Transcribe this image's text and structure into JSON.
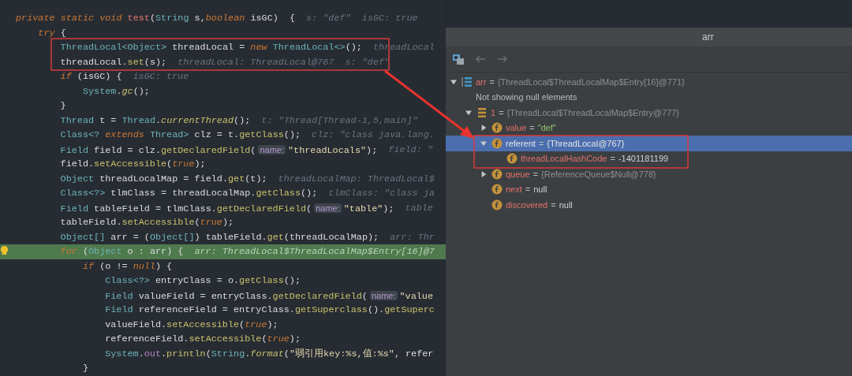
{
  "editor": {
    "lines": [
      {
        "current": false,
        "tokens": [
          {
            "kind": "kw",
            "t": "private static void "
          },
          {
            "kind": "def",
            "t": "test"
          },
          {
            "kind": "txt",
            "t": "("
          },
          {
            "kind": "type",
            "t": "String"
          },
          {
            "kind": "txt",
            "t": " s,"
          },
          {
            "kind": "kw",
            "t": "boolean"
          },
          {
            "kind": "txt",
            "t": " isGC)  {"
          }
        ],
        "hint": "s: \"def\"  isGC: true",
        "children": [
          {
            "current": false,
            "tokens": [
              {
                "kind": "kw",
                "t": "try"
              },
              {
                "kind": "txt",
                "t": " {"
              }
            ],
            "children": [
              {
                "current": false,
                "tokens": [
                  {
                    "kind": "type",
                    "t": "ThreadLocal<Object>"
                  },
                  {
                    "kind": "txt",
                    "t": " threadLocal = "
                  },
                  {
                    "kind": "kw",
                    "t": "new "
                  },
                  {
                    "kind": "type",
                    "t": "ThreadLocal<>"
                  },
                  {
                    "kind": "txt",
                    "t": "();"
                  }
                ],
                "hint": "threadLocal"
              },
              {
                "current": false,
                "tokens": [
                  {
                    "kind": "txt",
                    "t": "threadLocal."
                  },
                  {
                    "kind": "fn",
                    "t": "set"
                  },
                  {
                    "kind": "txt",
                    "t": "(s);"
                  }
                ],
                "hint": "threadLocal: ThreadLocal@767  s: \"def\""
              },
              {
                "current": false,
                "tokens": [
                  {
                    "kind": "kw",
                    "t": "if"
                  },
                  {
                    "kind": "txt",
                    "t": " (isGC) {"
                  }
                ],
                "hint": "isGC: true",
                "children": [
                  {
                    "current": false,
                    "tokens": [
                      {
                        "kind": "type",
                        "t": "System"
                      },
                      {
                        "kind": "txt",
                        "t": "."
                      },
                      {
                        "kind": "fni",
                        "t": "gc"
                      },
                      {
                        "kind": "txt",
                        "t": "();"
                      }
                    ]
                  }
                ]
              },
              {
                "current": false,
                "tokens": [
                  {
                    "kind": "txt",
                    "t": "}"
                  }
                ]
              },
              {
                "current": false,
                "tokens": [
                  {
                    "kind": "type",
                    "t": "Thread"
                  },
                  {
                    "kind": "txt",
                    "t": " t = "
                  },
                  {
                    "kind": "type",
                    "t": "Thread"
                  },
                  {
                    "kind": "txt",
                    "t": "."
                  },
                  {
                    "kind": "fni",
                    "t": "currentThread"
                  },
                  {
                    "kind": "txt",
                    "t": "();"
                  }
                ],
                "hint": "t: \"Thread[Thread-1,5,main]\""
              },
              {
                "current": false,
                "tokens": [
                  {
                    "kind": "type",
                    "t": "Class<?"
                  },
                  {
                    "kind": "kw",
                    "t": " extends "
                  },
                  {
                    "kind": "type",
                    "t": "Thread>"
                  },
                  {
                    "kind": "txt",
                    "t": " clz = t."
                  },
                  {
                    "kind": "fn",
                    "t": "getClass"
                  },
                  {
                    "kind": "txt",
                    "t": "();"
                  }
                ],
                "hint": "clz: \"class java.lang."
              },
              {
                "current": false,
                "tokens": [
                  {
                    "kind": "type",
                    "t": "Field"
                  },
                  {
                    "kind": "txt",
                    "t": " field = clz."
                  },
                  {
                    "kind": "fn",
                    "t": "getDeclaredField"
                  },
                  {
                    "kind": "txt",
                    "t": "("
                  },
                  {
                    "kind": "param",
                    "t": "name:"
                  },
                  {
                    "kind": "str",
                    "t": "\"threadLocals\""
                  },
                  {
                    "kind": "txt",
                    "t": ");"
                  }
                ],
                "hint": "field: \""
              },
              {
                "current": false,
                "tokens": [
                  {
                    "kind": "txt",
                    "t": "field."
                  },
                  {
                    "kind": "fn",
                    "t": "setAccessible"
                  },
                  {
                    "kind": "txt",
                    "t": "("
                  },
                  {
                    "kind": "kw",
                    "t": "true"
                  },
                  {
                    "kind": "txt",
                    "t": ");"
                  }
                ]
              },
              {
                "current": false,
                "tokens": [
                  {
                    "kind": "type",
                    "t": "Object"
                  },
                  {
                    "kind": "txt",
                    "t": " threadLocalMap = field."
                  },
                  {
                    "kind": "fn",
                    "t": "get"
                  },
                  {
                    "kind": "txt",
                    "t": "(t);"
                  }
                ],
                "hint": "threadLocalMap: ThreadLocal$"
              },
              {
                "current": false,
                "tokens": [
                  {
                    "kind": "type",
                    "t": "Class<?>"
                  },
                  {
                    "kind": "txt",
                    "t": " tlmClass = threadLocalMap."
                  },
                  {
                    "kind": "fn",
                    "t": "getClass"
                  },
                  {
                    "kind": "txt",
                    "t": "();"
                  }
                ],
                "hint": "tlmClass: \"class ja"
              },
              {
                "current": false,
                "tokens": [
                  {
                    "kind": "type",
                    "t": "Field"
                  },
                  {
                    "kind": "txt",
                    "t": " tableField = tlmClass."
                  },
                  {
                    "kind": "fn",
                    "t": "getDeclaredField"
                  },
                  {
                    "kind": "txt",
                    "t": "("
                  },
                  {
                    "kind": "param",
                    "t": "name:"
                  },
                  {
                    "kind": "str",
                    "t": "\"table\""
                  },
                  {
                    "kind": "txt",
                    "t": ");"
                  }
                ],
                "hint": "table"
              },
              {
                "current": false,
                "tokens": [
                  {
                    "kind": "txt",
                    "t": "tableField."
                  },
                  {
                    "kind": "fn",
                    "t": "setAccessible"
                  },
                  {
                    "kind": "txt",
                    "t": "("
                  },
                  {
                    "kind": "kw",
                    "t": "true"
                  },
                  {
                    "kind": "txt",
                    "t": ");"
                  }
                ]
              },
              {
                "current": false,
                "tokens": [
                  {
                    "kind": "type",
                    "t": "Object[]"
                  },
                  {
                    "kind": "txt",
                    "t": " arr = ("
                  },
                  {
                    "kind": "type",
                    "t": "Object[]"
                  },
                  {
                    "kind": "txt",
                    "t": ") tableField."
                  },
                  {
                    "kind": "fn",
                    "t": "get"
                  },
                  {
                    "kind": "txt",
                    "t": "(threadLocalMap);"
                  }
                ],
                "hint": "arr: Thr"
              },
              {
                "current": true,
                "tokens": [
                  {
                    "kind": "kw",
                    "t": "for"
                  },
                  {
                    "kind": "txt",
                    "t": " ("
                  },
                  {
                    "kind": "type",
                    "t": "Object"
                  },
                  {
                    "kind": "txt",
                    "t": " o : arr) {"
                  }
                ],
                "hint": "arr: ThreadLocal$ThreadLocalMap$Entry[16]@7",
                "children": [
                  {
                    "current": false,
                    "tokens": [
                      {
                        "kind": "kw",
                        "t": "if"
                      },
                      {
                        "kind": "txt",
                        "t": " (o != "
                      },
                      {
                        "kind": "kw",
                        "t": "null"
                      },
                      {
                        "kind": "txt",
                        "t": ") {"
                      }
                    ],
                    "children": [
                      {
                        "current": false,
                        "tokens": [
                          {
                            "kind": "type",
                            "t": "Class<?>"
                          },
                          {
                            "kind": "txt",
                            "t": " entryClass = o."
                          },
                          {
                            "kind": "fn",
                            "t": "getClass"
                          },
                          {
                            "kind": "txt",
                            "t": "();"
                          }
                        ]
                      },
                      {
                        "current": false,
                        "tokens": [
                          {
                            "kind": "type",
                            "t": "Field"
                          },
                          {
                            "kind": "txt",
                            "t": " valueField = entryClass."
                          },
                          {
                            "kind": "fn",
                            "t": "getDeclaredField"
                          },
                          {
                            "kind": "txt",
                            "t": "("
                          },
                          {
                            "kind": "param",
                            "t": "name:"
                          },
                          {
                            "kind": "str",
                            "t": "\"value"
                          }
                        ]
                      },
                      {
                        "current": false,
                        "tokens": [
                          {
                            "kind": "type",
                            "t": "Field"
                          },
                          {
                            "kind": "txt",
                            "t": " referenceField = entryClass."
                          },
                          {
                            "kind": "fn",
                            "t": "getSuperclass"
                          },
                          {
                            "kind": "txt",
                            "t": "()."
                          },
                          {
                            "kind": "fn",
                            "t": "getSuperc"
                          }
                        ]
                      },
                      {
                        "current": false,
                        "tokens": [
                          {
                            "kind": "txt",
                            "t": "valueField."
                          },
                          {
                            "kind": "fn",
                            "t": "setAccessible"
                          },
                          {
                            "kind": "txt",
                            "t": "("
                          },
                          {
                            "kind": "kw",
                            "t": "true"
                          },
                          {
                            "kind": "txt",
                            "t": ");"
                          }
                        ]
                      },
                      {
                        "current": false,
                        "tokens": [
                          {
                            "kind": "txt",
                            "t": "referenceField."
                          },
                          {
                            "kind": "fn",
                            "t": "setAccessible"
                          },
                          {
                            "kind": "txt",
                            "t": "("
                          },
                          {
                            "kind": "kw",
                            "t": "true"
                          },
                          {
                            "kind": "txt",
                            "t": ");"
                          }
                        ]
                      },
                      {
                        "current": false,
                        "tokens": [
                          {
                            "kind": "type",
                            "t": "System"
                          },
                          {
                            "kind": "txt",
                            "t": "."
                          },
                          {
                            "kind": "field",
                            "t": "out"
                          },
                          {
                            "kind": "txt",
                            "t": "."
                          },
                          {
                            "kind": "fn",
                            "t": "println"
                          },
                          {
                            "kind": "txt",
                            "t": "("
                          },
                          {
                            "kind": "type",
                            "t": "String"
                          },
                          {
                            "kind": "txt",
                            "t": "."
                          },
                          {
                            "kind": "fni",
                            "t": "format"
                          },
                          {
                            "kind": "txt",
                            "t": "("
                          },
                          {
                            "kind": "str",
                            "t": "\"弱引用key:%s,值:%s\""
                          },
                          {
                            "kind": "txt",
                            "t": ", refer"
                          }
                        ]
                      }
                    ]
                  },
                  {
                    "current": false,
                    "tokens": [
                      {
                        "kind": "txt",
                        "t": "}"
                      }
                    ]
                  }
                ]
              }
            ]
          }
        ]
      }
    ]
  },
  "popup": {
    "title": "arr",
    "tree": [
      {
        "kind": "array",
        "name": "arr",
        "separator": "=",
        "value": {
          "kind": "object",
          "text": "{ThreadLocal$ThreadLocalMap$Entry[16]@771}"
        },
        "expanded": true,
        "selected": false,
        "children": [
          {
            "kind": "note",
            "text": "Not showing null elements"
          },
          {
            "kind": "entry",
            "name": "1",
            "separator": "=",
            "value": {
              "kind": "object",
              "text": "{ThreadLocal$ThreadLocalMap$Entry@777}"
            },
            "expanded": true,
            "selected": false,
            "children": [
              {
                "kind": "field",
                "name": "value",
                "separator": "=",
                "value": {
                  "kind": "string",
                  "text": "\"def\""
                },
                "expanded": false,
                "selected": false
              },
              {
                "kind": "field",
                "name": "referent",
                "separator": "=",
                "value": {
                  "kind": "object",
                  "text": "{ThreadLocal@767}"
                },
                "expanded": true,
                "selected": true,
                "children": [
                  {
                    "kind": "field",
                    "name": "threadLocalHashCode",
                    "separator": "=",
                    "value": {
                      "kind": "literal",
                      "text": "-1401181199"
                    },
                    "selected": false
                  }
                ]
              },
              {
                "kind": "field",
                "name": "queue",
                "separator": "=",
                "value": {
                  "kind": "object",
                  "text": "{ReferenceQueue$Null@778}"
                },
                "expanded": false,
                "selected": false
              },
              {
                "kind": "field",
                "name": "next",
                "separator": "=",
                "value": {
                  "kind": "literal",
                  "text": "null"
                },
                "selected": false
              },
              {
                "kind": "field",
                "name": "discovered",
                "separator": "=",
                "value": {
                  "kind": "literal",
                  "text": "null"
                },
                "selected": false
              }
            ]
          }
        ]
      }
    ]
  }
}
